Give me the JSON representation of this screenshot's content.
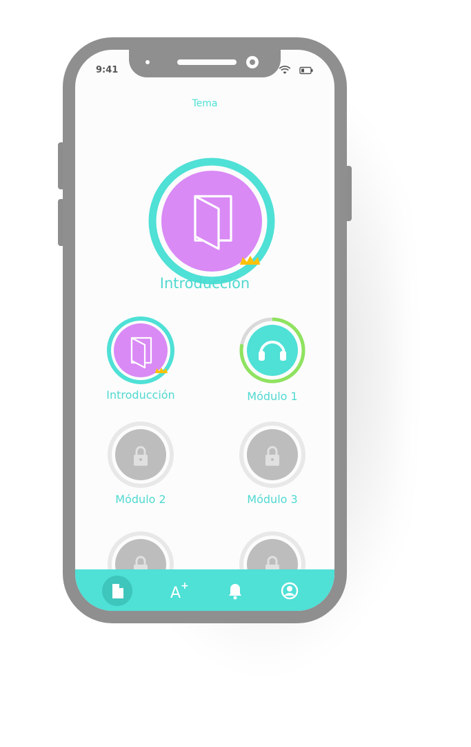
{
  "status_bar": {
    "time": "9:41"
  },
  "header": {
    "title": "Tema"
  },
  "featured": {
    "label": "Introducción"
  },
  "modules": [
    {
      "label": "Introducción",
      "icon": "book-icon",
      "state": "completed",
      "progress": 1.0
    },
    {
      "label": "Módulo 1",
      "icon": "headphones-icon",
      "state": "in-progress",
      "progress": 0.78
    },
    {
      "label": "Módulo 2",
      "icon": "lock-icon",
      "state": "locked"
    },
    {
      "label": "Módulo 3",
      "icon": "lock-icon",
      "state": "locked"
    },
    {
      "label": "",
      "icon": "lock-icon",
      "state": "locked"
    },
    {
      "label": "",
      "icon": "lock-icon",
      "state": "locked"
    }
  ],
  "tabbar": {
    "items": [
      {
        "name": "document-icon",
        "active": true
      },
      {
        "name": "a-plus-icon",
        "label": "A",
        "sup": "+"
      },
      {
        "name": "bell-icon"
      },
      {
        "name": "profile-icon"
      }
    ]
  },
  "colors": {
    "accent": "#4fe0d6",
    "purple": "#d98af5",
    "locked": "#bdbdbd",
    "ring_locked": "#e8e8e8",
    "green": "#8fe35f",
    "crown": "#ffc107",
    "frame": "#8f8f8f"
  }
}
